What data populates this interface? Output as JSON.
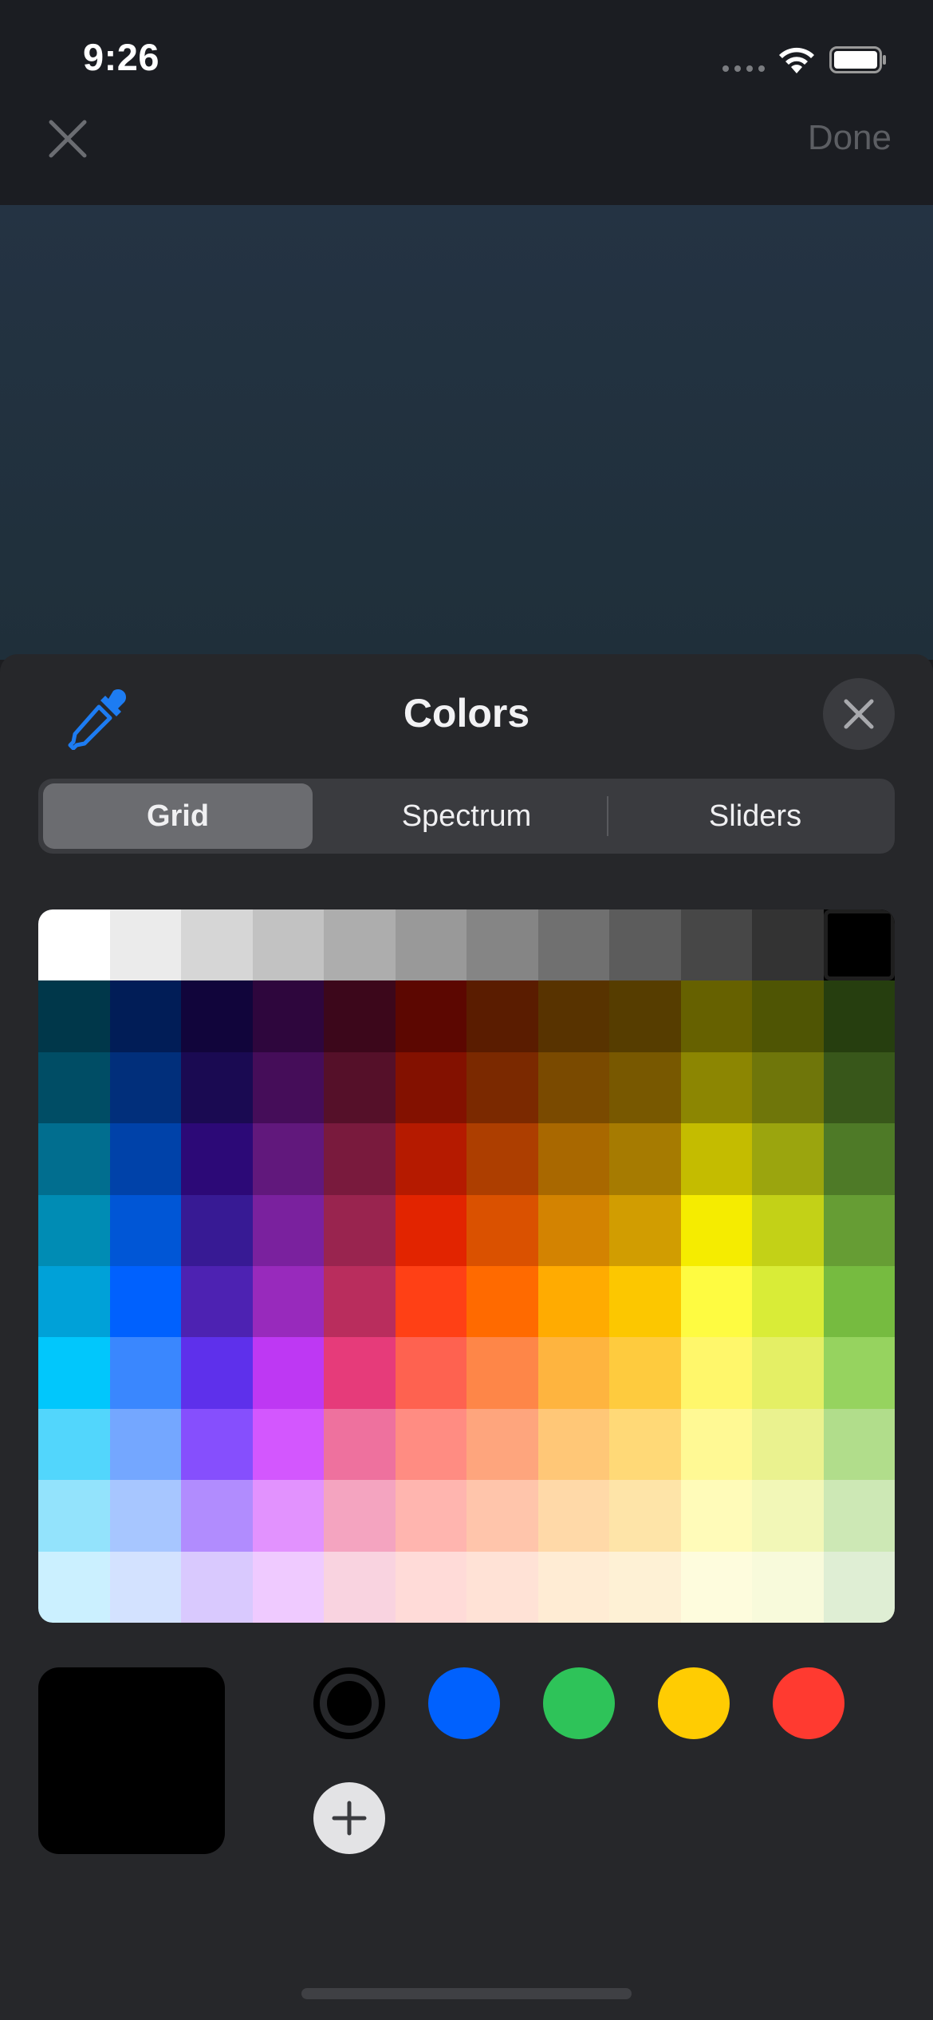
{
  "status_bar": {
    "time": "9:26"
  },
  "nav": {
    "done_label": "Done"
  },
  "sheet": {
    "title": "Colors",
    "tabs": [
      {
        "label": "Grid",
        "active": true
      },
      {
        "label": "Spectrum",
        "active": false
      },
      {
        "label": "Sliders",
        "active": false
      }
    ]
  },
  "colors": {
    "accent_blue": "#1d7cf2",
    "current_color": "#000000"
  },
  "grid_colors": [
    [
      "#ffffff",
      "#ebebeb",
      "#d6d6d6",
      "#c2c2c2",
      "#adadad",
      "#999999",
      "#858585",
      "#707070",
      "#5c5c5c",
      "#474747",
      "#333333",
      "#000000"
    ],
    [
      "#00374a",
      "#011d57",
      "#11053b",
      "#2e063d",
      "#3c071b",
      "#5c0701",
      "#5a1c00",
      "#583300",
      "#563d00",
      "#666100",
      "#4f5504",
      "#263e0f"
    ],
    [
      "#004d65",
      "#012f7b",
      "#1a0a52",
      "#450d59",
      "#551029",
      "#831100",
      "#7b2900",
      "#7a4a00",
      "#785800",
      "#8c8602",
      "#6f760a",
      "#38571a"
    ],
    [
      "#016e8f",
      "#0042a9",
      "#2c0977",
      "#61187c",
      "#791a3d",
      "#b51a00",
      "#ad3e00",
      "#a96800",
      "#a67b01",
      "#c4bc00",
      "#9ba50e",
      "#4e7a27"
    ],
    [
      "#008cb4",
      "#0056d6",
      "#371a94",
      "#7a219e",
      "#99244f",
      "#e22400",
      "#da5100",
      "#d38301",
      "#d19d01",
      "#f5ec00",
      "#c3d117",
      "#669d34"
    ],
    [
      "#00a1d8",
      "#0061fe",
      "#4d22b2",
      "#982abc",
      "#b92d5d",
      "#ff4015",
      "#ff6a00",
      "#ffab01",
      "#fcc700",
      "#fefb41",
      "#d9ec37",
      "#76bb40"
    ],
    [
      "#01c7fc",
      "#3a87fe",
      "#5e30eb",
      "#be38f3",
      "#e63b7a",
      "#fe6250",
      "#fe8648",
      "#feb43f",
      "#fecb3e",
      "#fff76b",
      "#e4ef65",
      "#96d35f"
    ],
    [
      "#52d6fc",
      "#74a7ff",
      "#864ffd",
      "#d357fe",
      "#ee719e",
      "#ff8c82",
      "#fea57d",
      "#ffc777",
      "#ffd977",
      "#fff994",
      "#eaf28f",
      "#b1dd8b"
    ],
    [
      "#93e3fc",
      "#a7c6ff",
      "#b18cfe",
      "#e292fe",
      "#f4a4c0",
      "#ffb5af",
      "#ffc5ab",
      "#ffd9a8",
      "#fee4a8",
      "#fffbb9",
      "#f2f7b7",
      "#cde8b5"
    ],
    [
      "#cbf0ff",
      "#d3e2ff",
      "#d9c9fe",
      "#efcaff",
      "#f9d3e0",
      "#ffdbd8",
      "#ffe2d6",
      "#ffecd4",
      "#fef1d5",
      "#fefcdd",
      "#f8fadb",
      "#dfeed4"
    ]
  ],
  "selected_cell": {
    "row": 0,
    "col": 11
  },
  "swatches": [
    {
      "color": "#000000",
      "selected": true
    },
    {
      "color": "#0061fe",
      "selected": false
    },
    {
      "color": "#2ec359",
      "selected": false
    },
    {
      "color": "#ffcc02",
      "selected": false
    },
    {
      "color": "#ff3a30",
      "selected": false
    }
  ]
}
